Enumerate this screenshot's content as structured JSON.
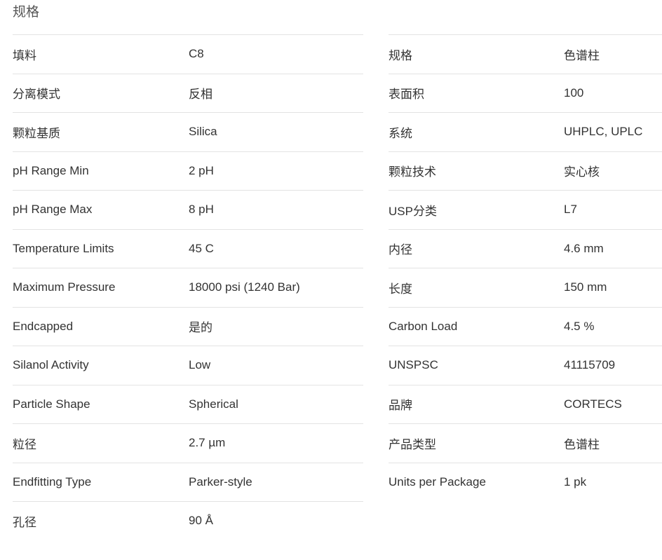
{
  "section": {
    "title": "规格"
  },
  "left_specs": [
    {
      "label": "填料",
      "value": "C8"
    },
    {
      "label": "分离模式",
      "value": "反相"
    },
    {
      "label": "颗粒基质",
      "value": "Silica"
    },
    {
      "label": "pH Range Min",
      "value": "2 pH"
    },
    {
      "label": "pH Range Max",
      "value": "8 pH"
    },
    {
      "label": "Temperature Limits",
      "value": "45 C"
    },
    {
      "label": "Maximum Pressure",
      "value": "18000 psi (1240 Bar)"
    },
    {
      "label": "Endcapped",
      "value": "是的"
    },
    {
      "label": "Silanol Activity",
      "value": "Low"
    },
    {
      "label": "Particle Shape",
      "value": "Spherical"
    },
    {
      "label": "粒径",
      "value": "2.7 µm"
    },
    {
      "label": "Endfitting Type",
      "value": "Parker-style"
    },
    {
      "label": "孔径",
      "value": "90 Å"
    }
  ],
  "right_specs": [
    {
      "label": "规格",
      "value": "色谱柱"
    },
    {
      "label": "表面积",
      "value": "100"
    },
    {
      "label": "系统",
      "value": "UHPLC, UPLC"
    },
    {
      "label": "颗粒技术",
      "value": "实心核"
    },
    {
      "label": "USP分类",
      "value": "L7"
    },
    {
      "label": "内径",
      "value": "4.6 mm"
    },
    {
      "label": "长度",
      "value": "150 mm"
    },
    {
      "label": "Carbon Load",
      "value": "4.5 %"
    },
    {
      "label": "UNSPSC",
      "value": "41115709"
    },
    {
      "label": "品牌",
      "value": "CORTECS"
    },
    {
      "label": "产品类型",
      "value": "色谱柱"
    },
    {
      "label": "Units per Package",
      "value": "1 pk"
    }
  ]
}
